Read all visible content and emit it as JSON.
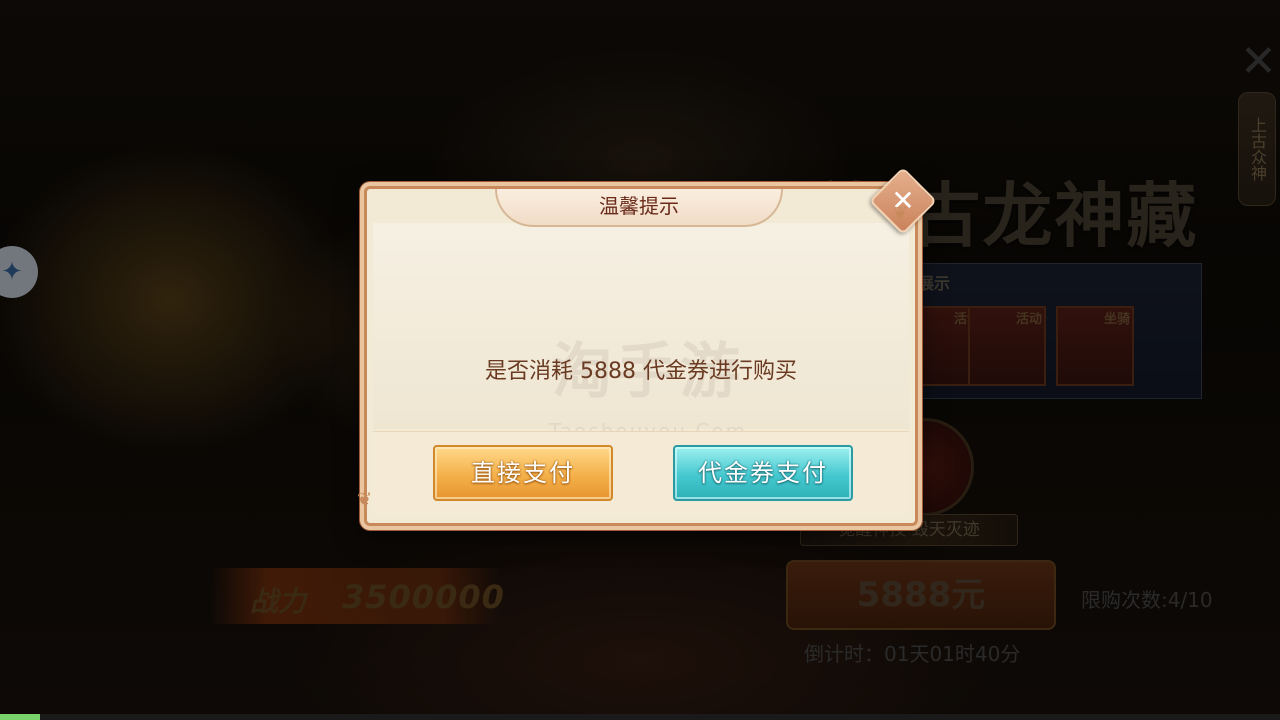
{
  "background": {
    "banner_title": "开放 古龙神藏",
    "showcase_label": "展示",
    "showcase_tags": [
      "活动",
      "活动",
      "坐骑"
    ],
    "side_tab": "上古众神",
    "power_label": "战力",
    "power_value": "3500000",
    "skill_caption": "觉醒神技 毁天灭迹",
    "price": "5888元",
    "purchase_limit": "限购次数:4/10",
    "countdown": "倒计时：01天01时40分",
    "watermark": "淘手游",
    "watermark_sub": "Taoshouyou.Com"
  },
  "dialog": {
    "title": "温馨提示",
    "message": "是否消耗 5888 代金券进行购买",
    "direct_pay_label": "直接支付",
    "coupon_pay_label": "代金券支付",
    "close_icon": "close-flower-icon"
  },
  "colors": {
    "dialog_bg": "#f3ead6",
    "title_text": "#6a2a1a",
    "direct_button": "#f4b04a",
    "coupon_button": "#45c8cf"
  }
}
